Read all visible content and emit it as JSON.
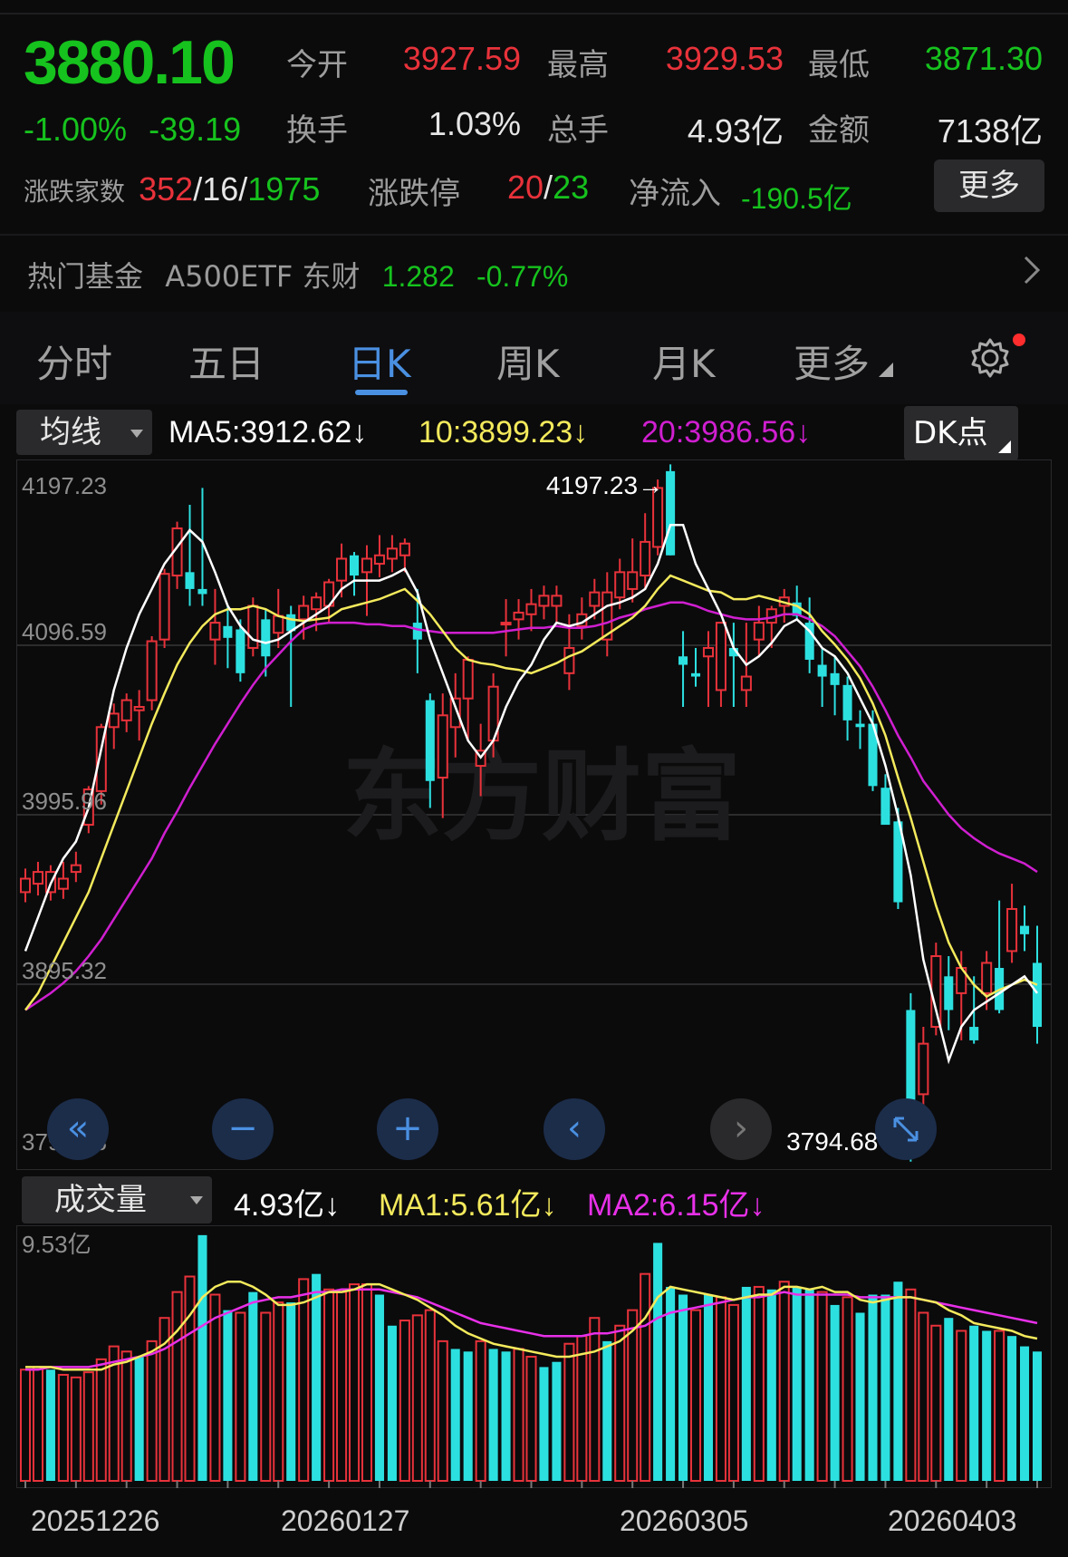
{
  "quote": {
    "price": "3880.10",
    "change_pct": "-1.00%",
    "change_abs": "-39.19",
    "open_label": "今开",
    "open": "3927.59",
    "high_label": "最高",
    "high": "3929.53",
    "low_label": "最低",
    "low": "3871.30",
    "turnover_label": "换手",
    "turnover": "1.03%",
    "volume_label": "总手",
    "volume": "4.93亿",
    "amount_label": "金额",
    "amount": "7138亿",
    "breadth_label": "涨跌家数",
    "breadth_up": "352",
    "breadth_flat": "16",
    "breadth_down": "1975",
    "limit_label": "涨跌停",
    "limit_up": "20",
    "limit_down": "23",
    "netflow_label": "净流入",
    "netflow": "-190.5亿",
    "more_button": "更多"
  },
  "hot_fund": {
    "label": "热门基金",
    "name": "A500ETF 东财",
    "price": "1.282",
    "change": "-0.77%"
  },
  "tabs": [
    "分时",
    "五日",
    "日K",
    "周K",
    "月K",
    "更多"
  ],
  "active_tab": "日K",
  "ma_legend": {
    "selector": "均线",
    "ma5": "MA5:3912.62↓",
    "ma10": "10:3899.23↓",
    "ma20": "20:3986.56↓",
    "dk_button": "DK点"
  },
  "volume_legend": {
    "selector": "成交量",
    "current": "4.93亿↓",
    "ma1": "MA1:5.61亿↓",
    "ma2": "MA2:6.15亿↓"
  },
  "watermark": "东方财富",
  "colors": {
    "up": "#e8323a",
    "down": "#2de0e0",
    "price_green": "#16c21d",
    "ma5": "#ffffff",
    "ma10": "#f4ea5c",
    "ma20": "#d01fd0",
    "accent": "#4a90e2"
  },
  "chart_data": {
    "type": "candlestick",
    "ylim": [
      3794.68,
      4197.23
    ],
    "y_ticks": [
      "4197.23",
      "4096.59",
      "3995.96",
      "3895.32",
      "3794.68"
    ],
    "max_label": "4197.23→",
    "min_label": "3794.68→",
    "volume_ylim": [
      0,
      9.53
    ],
    "volume_top_label": "9.53亿",
    "x_labels": [
      "20251226",
      "20260127",
      "20260305",
      "20260403"
    ],
    "candles": [
      [
        3950,
        3964,
        3944,
        3958
      ],
      [
        3955,
        3968,
        3948,
        3962
      ],
      [
        3950,
        3966,
        3945,
        3962
      ],
      [
        3952,
        3968,
        3946,
        3958
      ],
      [
        3962,
        3974,
        3956,
        3966
      ],
      [
        3990,
        4013,
        3985,
        4011
      ],
      [
        4010,
        4050,
        4002,
        4048
      ],
      [
        4048,
        4062,
        4035,
        4056
      ],
      [
        4052,
        4068,
        4045,
        4064
      ],
      [
        4058,
        4070,
        4040,
        4060
      ],
      [
        4064,
        4102,
        4058,
        4099
      ],
      [
        4100,
        4142,
        4095,
        4139
      ],
      [
        4138,
        4170,
        4130,
        4166
      ],
      [
        4140,
        4180,
        4120,
        4130
      ],
      [
        4130,
        4190,
        4120,
        4127
      ],
      [
        4100,
        4130,
        4085,
        4110
      ],
      [
        4108,
        4120,
        4083,
        4101
      ],
      [
        4106,
        4112,
        4075,
        4080
      ],
      [
        4095,
        4125,
        4090,
        4120
      ],
      [
        4112,
        4118,
        4078,
        4090
      ],
      [
        4104,
        4130,
        4095,
        4114
      ],
      [
        4115,
        4120,
        4060,
        4105
      ],
      [
        4112,
        4126,
        4100,
        4120
      ],
      [
        4118,
        4128,
        4105,
        4125
      ],
      [
        4120,
        4136,
        4110,
        4134
      ],
      [
        4135,
        4157,
        4125,
        4148
      ],
      [
        4150,
        4152,
        4126,
        4138
      ],
      [
        4140,
        4156,
        4114,
        4148
      ],
      [
        4145,
        4162,
        4137,
        4150
      ],
      [
        4148,
        4162,
        4140,
        4154
      ],
      [
        4150,
        4160,
        4140,
        4157
      ],
      [
        4110,
        4130,
        4080,
        4100
      ],
      [
        4064,
        4068,
        4000,
        4016
      ],
      [
        4018,
        4068,
        3994,
        4055
      ],
      [
        4048,
        4080,
        4030,
        4065
      ],
      [
        4065,
        4090,
        4040,
        4088
      ],
      [
        4025,
        4050,
        4007,
        4034
      ],
      [
        4040,
        4080,
        4030,
        4072
      ],
      [
        4110,
        4124,
        4090,
        4110
      ],
      [
        4112,
        4124,
        4100,
        4116
      ],
      [
        4115,
        4130,
        4105,
        4121
      ],
      [
        4120,
        4132,
        4112,
        4126
      ],
      [
        4120,
        4132,
        4110,
        4126
      ],
      [
        4080,
        4115,
        4070,
        4095
      ],
      [
        4108,
        4125,
        4100,
        4115
      ],
      [
        4120,
        4136,
        4112,
        4128
      ],
      [
        4100,
        4140,
        4090,
        4128
      ],
      [
        4125,
        4148,
        4118,
        4140
      ],
      [
        4130,
        4160,
        4122,
        4140
      ],
      [
        4138,
        4175,
        4130,
        4158
      ],
      [
        4155,
        4195,
        4150,
        4190
      ],
      [
        4200,
        4204,
        4150,
        4150
      ],
      [
        4090,
        4105,
        4060,
        4085
      ],
      [
        4080,
        4095,
        4072,
        4078
      ],
      [
        4090,
        4105,
        4060,
        4095
      ],
      [
        4070,
        4105,
        4060,
        4110
      ],
      [
        4095,
        4110,
        4060,
        4090
      ],
      [
        4070,
        4110,
        4060,
        4078
      ],
      [
        4100,
        4120,
        4090,
        4110
      ],
      [
        4110,
        4120,
        4095,
        4118
      ],
      [
        4120,
        4130,
        4110,
        4125
      ],
      [
        4122,
        4132,
        4112,
        4114
      ],
      [
        4110,
        4125,
        4080,
        4088
      ],
      [
        4085,
        4095,
        4060,
        4078
      ],
      [
        4080,
        4090,
        4055,
        4073
      ],
      [
        4073,
        4078,
        4040,
        4052
      ],
      [
        4050,
        4058,
        4035,
        4048
      ],
      [
        4050,
        4058,
        4010,
        4013
      ],
      [
        4012,
        4020,
        3998,
        3990
      ],
      [
        3992,
        4000,
        3940,
        3944
      ],
      [
        3880,
        3890,
        3790,
        3810
      ],
      [
        3830,
        3870,
        3815,
        3860
      ],
      [
        3870,
        3920,
        3865,
        3912
      ],
      [
        3900,
        3912,
        3868,
        3880
      ],
      [
        3890,
        3915,
        3862,
        3905
      ],
      [
        3870,
        3900,
        3860,
        3862
      ],
      [
        3890,
        3915,
        3880,
        3908
      ],
      [
        3905,
        3945,
        3878,
        3880
      ],
      [
        3915,
        3955,
        3908,
        3940
      ],
      [
        3930,
        3942,
        3915,
        3925
      ],
      [
        3908,
        3930,
        3860,
        3870
      ]
    ],
    "ma5": [
      3915,
      3935,
      3955,
      3970,
      3980,
      4000,
      4035,
      4070,
      4095,
      4115,
      4130,
      4145,
      4155,
      4165,
      4158,
      4140,
      4120,
      4108,
      4100,
      4098,
      4100,
      4105,
      4110,
      4115,
      4120,
      4130,
      4135,
      4135,
      4135,
      4138,
      4142,
      4128,
      4100,
      4080,
      4060,
      4040,
      4030,
      4040,
      4060,
      4075,
      4085,
      4100,
      4110,
      4108,
      4110,
      4115,
      4120,
      4122,
      4125,
      4130,
      4145,
      4168,
      4168,
      4145,
      4130,
      4115,
      4095,
      4085,
      4090,
      4098,
      4108,
      4112,
      4105,
      4095,
      4090,
      4080,
      4065,
      4050,
      4025,
      3995,
      3960,
      3910,
      3880,
      3850,
      3870,
      3880,
      3885,
      3890,
      3895,
      3900,
      3890
    ],
    "ma10": [
      3880,
      3890,
      3905,
      3920,
      3935,
      3950,
      3970,
      3990,
      4010,
      4030,
      4050,
      4068,
      4085,
      4098,
      4108,
      4115,
      4118,
      4118,
      4120,
      4118,
      4114,
      4112,
      4111,
      4112,
      4113,
      4118,
      4120,
      4122,
      4124,
      4127,
      4130,
      4123,
      4115,
      4105,
      4095,
      4088,
      4086,
      4085,
      4083,
      4082,
      4080,
      4083,
      4086,
      4090,
      4093,
      4098,
      4103,
      4108,
      4113,
      4120,
      4130,
      4138,
      4135,
      4132,
      4129,
      4128,
      4124,
      4124,
      4126,
      4124,
      4122,
      4120,
      4115,
      4105,
      4097,
      4088,
      4077,
      4062,
      4043,
      4018,
      3994,
      3968,
      3942,
      3920,
      3905,
      3895,
      3888,
      3892,
      3895,
      3898,
      3895
    ],
    "ma20": [
      3880,
      3885,
      3890,
      3896,
      3903,
      3912,
      3922,
      3934,
      3946,
      3958,
      3970,
      3985,
      3998,
      4012,
      4025,
      4038,
      4050,
      4062,
      4073,
      4083,
      4091,
      4099,
      4106,
      4109,
      4110,
      4110,
      4110,
      4109,
      4109,
      4108,
      4108,
      4106,
      4105,
      4104,
      4104,
      4104,
      4104,
      4104,
      4105,
      4106,
      4107,
      4107,
      4108,
      4107,
      4107,
      4108,
      4110,
      4113,
      4115,
      4118,
      4120,
      4122,
      4122,
      4120,
      4117,
      4115,
      4113,
      4112,
      4112,
      4113,
      4115,
      4115,
      4112,
      4108,
      4102,
      4093,
      4084,
      4072,
      4058,
      4043,
      4030,
      4016,
      4006,
      3996,
      3988,
      3982,
      3977,
      3973,
      3970,
      3967,
      3962
    ],
    "volume": [
      [
        4.3,
        1
      ],
      [
        4.4,
        1
      ],
      [
        4.3,
        0
      ],
      [
        4.1,
        1
      ],
      [
        4.0,
        1
      ],
      [
        4.2,
        1
      ],
      [
        4.7,
        1
      ],
      [
        5.2,
        1
      ],
      [
        5.0,
        1
      ],
      [
        4.8,
        0
      ],
      [
        5.4,
        1
      ],
      [
        6.3,
        1
      ],
      [
        7.3,
        1
      ],
      [
        7.9,
        1
      ],
      [
        9.5,
        0
      ],
      [
        7.2,
        1
      ],
      [
        6.6,
        0
      ],
      [
        6.5,
        1
      ],
      [
        7.3,
        0
      ],
      [
        6.5,
        1
      ],
      [
        6.9,
        1
      ],
      [
        6.9,
        0
      ],
      [
        7.8,
        1
      ],
      [
        8.0,
        0
      ],
      [
        7.4,
        1
      ],
      [
        7.3,
        1
      ],
      [
        7.6,
        1
      ],
      [
        7.6,
        1
      ],
      [
        7.2,
        0
      ],
      [
        6.0,
        0
      ],
      [
        6.2,
        1
      ],
      [
        6.4,
        1
      ],
      [
        6.6,
        1
      ],
      [
        5.4,
        1
      ],
      [
        5.1,
        0
      ],
      [
        5.0,
        0
      ],
      [
        5.4,
        1
      ],
      [
        5.1,
        0
      ],
      [
        5.0,
        0
      ],
      [
        5.1,
        1
      ],
      [
        4.8,
        1
      ],
      [
        4.4,
        0
      ],
      [
        4.6,
        0
      ],
      [
        5.3,
        1
      ],
      [
        5.6,
        1
      ],
      [
        6.3,
        1
      ],
      [
        5.4,
        0
      ],
      [
        6.0,
        1
      ],
      [
        6.6,
        1
      ],
      [
        8.0,
        1
      ],
      [
        9.2,
        0
      ],
      [
        7.5,
        0
      ],
      [
        7.2,
        0
      ],
      [
        6.6,
        1
      ],
      [
        7.2,
        0
      ],
      [
        7.1,
        1
      ],
      [
        6.8,
        1
      ],
      [
        7.5,
        0
      ],
      [
        7.5,
        1
      ],
      [
        7.4,
        0
      ],
      [
        7.7,
        1
      ],
      [
        7.5,
        0
      ],
      [
        7.4,
        0
      ],
      [
        7.3,
        1
      ],
      [
        6.8,
        0
      ],
      [
        7.1,
        1
      ],
      [
        6.5,
        0
      ],
      [
        7.2,
        0
      ],
      [
        7.2,
        0
      ],
      [
        7.7,
        0
      ],
      [
        7.4,
        1
      ],
      [
        6.5,
        1
      ],
      [
        6.0,
        1
      ],
      [
        6.3,
        0
      ],
      [
        5.8,
        1
      ],
      [
        6.0,
        0
      ],
      [
        5.8,
        0
      ],
      [
        5.8,
        1
      ],
      [
        5.6,
        0
      ],
      [
        5.2,
        0
      ],
      [
        5.0,
        0
      ]
    ],
    "volume_ma1": [
      4.4,
      4.4,
      4.4,
      4.3,
      4.3,
      4.3,
      4.3,
      4.5,
      4.6,
      4.8,
      5.0,
      5.3,
      5.8,
      6.4,
      7.1,
      7.5,
      7.7,
      7.7,
      7.5,
      7.2,
      6.8,
      6.8,
      6.9,
      7.1,
      7.3,
      7.3,
      7.4,
      7.6,
      7.6,
      7.4,
      7.2,
      7.0,
      6.7,
      6.4,
      6.0,
      5.7,
      5.5,
      5.3,
      5.2,
      5.1,
      5.0,
      4.9,
      4.8,
      4.8,
      4.9,
      5.0,
      5.2,
      5.4,
      5.8,
      6.3,
      7.1,
      7.5,
      7.4,
      7.3,
      7.2,
      7.1,
      7.0,
      7.1,
      7.2,
      7.2,
      7.5,
      7.5,
      7.4,
      7.5,
      7.3,
      7.3,
      7.0,
      6.9,
      7.0,
      7.1,
      7.1,
      7.0,
      6.9,
      6.6,
      6.4,
      6.1,
      6.0,
      5.9,
      5.8,
      5.6,
      5.5
    ],
    "volume_ma2": [
      4.3,
      4.3,
      4.4,
      4.4,
      4.4,
      4.4,
      4.5,
      4.6,
      4.7,
      4.8,
      4.9,
      5.1,
      5.4,
      5.7,
      6.0,
      6.3,
      6.5,
      6.7,
      6.9,
      7.0,
      7.1,
      7.1,
      7.2,
      7.3,
      7.3,
      7.4,
      7.4,
      7.4,
      7.4,
      7.3,
      7.2,
      7.1,
      6.9,
      6.7,
      6.5,
      6.3,
      6.1,
      6.0,
      5.9,
      5.8,
      5.7,
      5.6,
      5.6,
      5.6,
      5.6,
      5.7,
      5.7,
      5.8,
      5.9,
      6.0,
      6.3,
      6.5,
      6.6,
      6.7,
      6.8,
      6.9,
      7.0,
      7.1,
      7.1,
      7.2,
      7.3,
      7.2,
      7.2,
      7.2,
      7.2,
      7.2,
      7.1,
      7.1,
      7.1,
      7.1,
      7.1,
      7.0,
      6.9,
      6.8,
      6.7,
      6.6,
      6.5,
      6.4,
      6.3,
      6.2,
      6.1
    ]
  }
}
